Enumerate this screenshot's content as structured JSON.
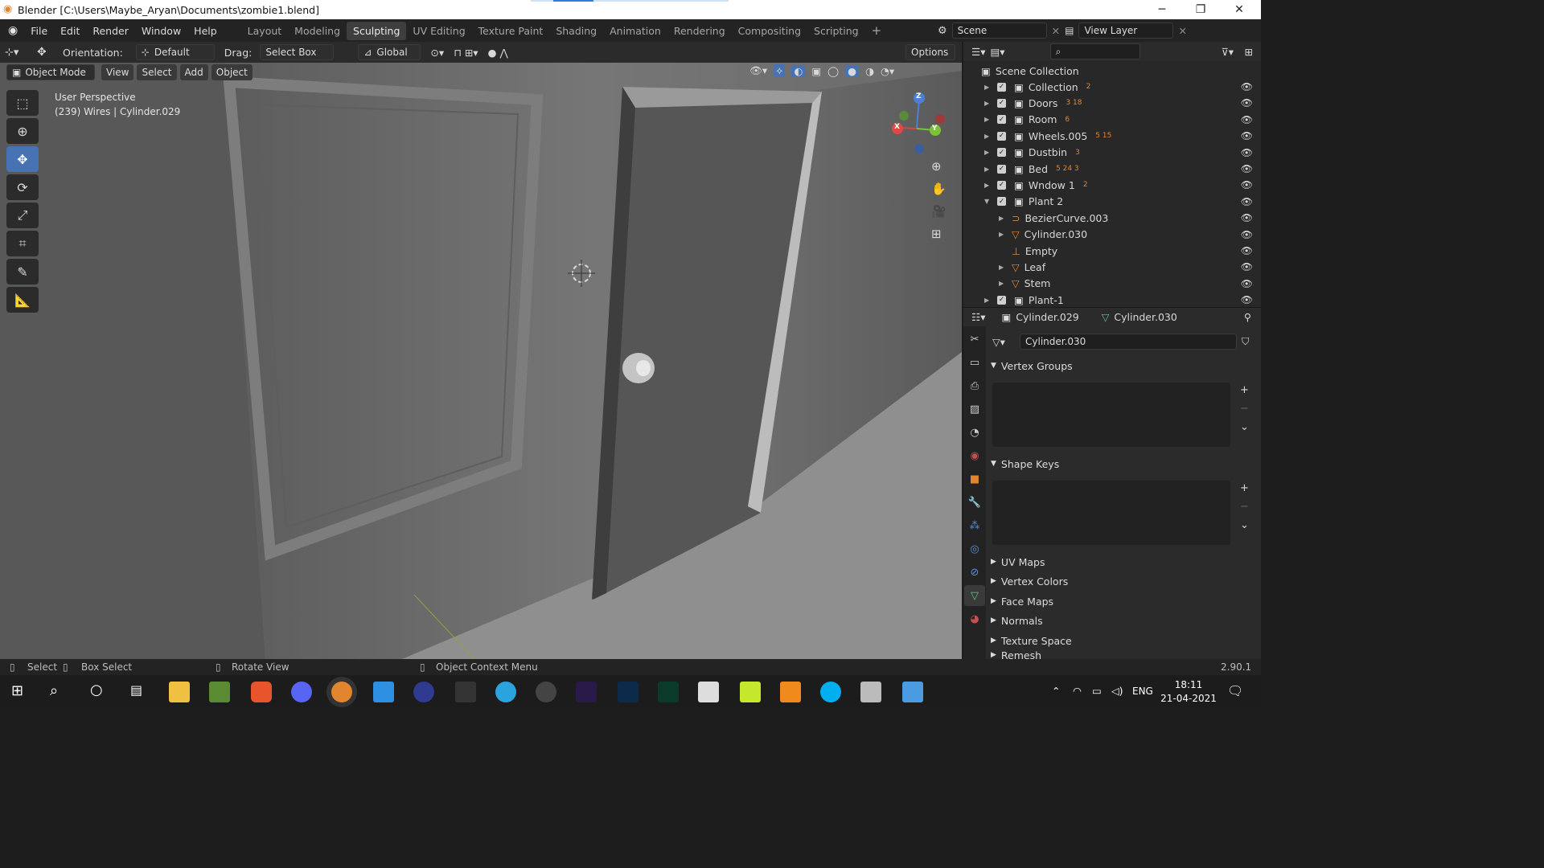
{
  "window": {
    "title": "Blender [C:\\Users\\Maybe_Aryan\\Documents\\zombie1.blend]"
  },
  "menu": [
    "File",
    "Edit",
    "Render",
    "Window",
    "Help"
  ],
  "workspaces": [
    "Layout",
    "Modeling",
    "Sculpting",
    "UV Editing",
    "Texture Paint",
    "Shading",
    "Animation",
    "Rendering",
    "Compositing",
    "Scripting"
  ],
  "active_workspace": "Sculpting",
  "scene": {
    "name": "Scene",
    "view_layer": "View Layer"
  },
  "tool_header": {
    "orientation_label": "Orientation:",
    "orientation_value": "Default",
    "drag_label": "Drag:",
    "drag_value": "Select Box",
    "transform_value": "Global",
    "options_label": "Options"
  },
  "viewport_header": {
    "mode": "Object Mode",
    "view": "View",
    "select": "Select",
    "add": "Add",
    "object": "Object"
  },
  "viewport": {
    "perspective": "User Perspective",
    "info": "(239) Wires | Cylinder.029"
  },
  "gizmo": {
    "x": "X",
    "y": "Y",
    "z": "Z"
  },
  "outliner": {
    "root": "Scene Collection",
    "items": [
      {
        "name": "Collection",
        "badge": "2"
      },
      {
        "name": "Doors",
        "badge": "3 18"
      },
      {
        "name": "Room",
        "badge": "6"
      },
      {
        "name": "Wheels.005",
        "badge": "5 15"
      },
      {
        "name": "Dustbin",
        "badge": "3"
      },
      {
        "name": "Bed",
        "badge": "5 24 3"
      },
      {
        "name": "Wndow 1",
        "badge": "2"
      },
      {
        "name": "Plant 2",
        "badge": ""
      },
      {
        "name": "BezierCurve.003",
        "badge": ""
      },
      {
        "name": "Cylinder.030",
        "badge": ""
      },
      {
        "name": "Empty",
        "badge": ""
      },
      {
        "name": "Leaf",
        "badge": ""
      },
      {
        "name": "Stem",
        "badge": ""
      },
      {
        "name": "Plant-1",
        "badge": ""
      }
    ]
  },
  "properties": {
    "object": "Cylinder.029",
    "mesh": "Cylinder.030",
    "datablock": "Cylinder.030",
    "panels": [
      "Vertex Groups",
      "Shape Keys",
      "UV Maps",
      "Vertex Colors",
      "Face Maps",
      "Normals",
      "Texture Space",
      "Remesh"
    ]
  },
  "statusbar": {
    "select": "Select",
    "box_select": "Box Select",
    "rotate_view": "Rotate View",
    "context_menu": "Object Context Menu",
    "version": "2.90.1"
  },
  "taskbar": {
    "lang": "ENG",
    "time": "18:11",
    "date": "21-04-2021"
  },
  "colors": {
    "accent": "#4772b3",
    "orange": "#e2852f",
    "green": "#5ec28b"
  }
}
